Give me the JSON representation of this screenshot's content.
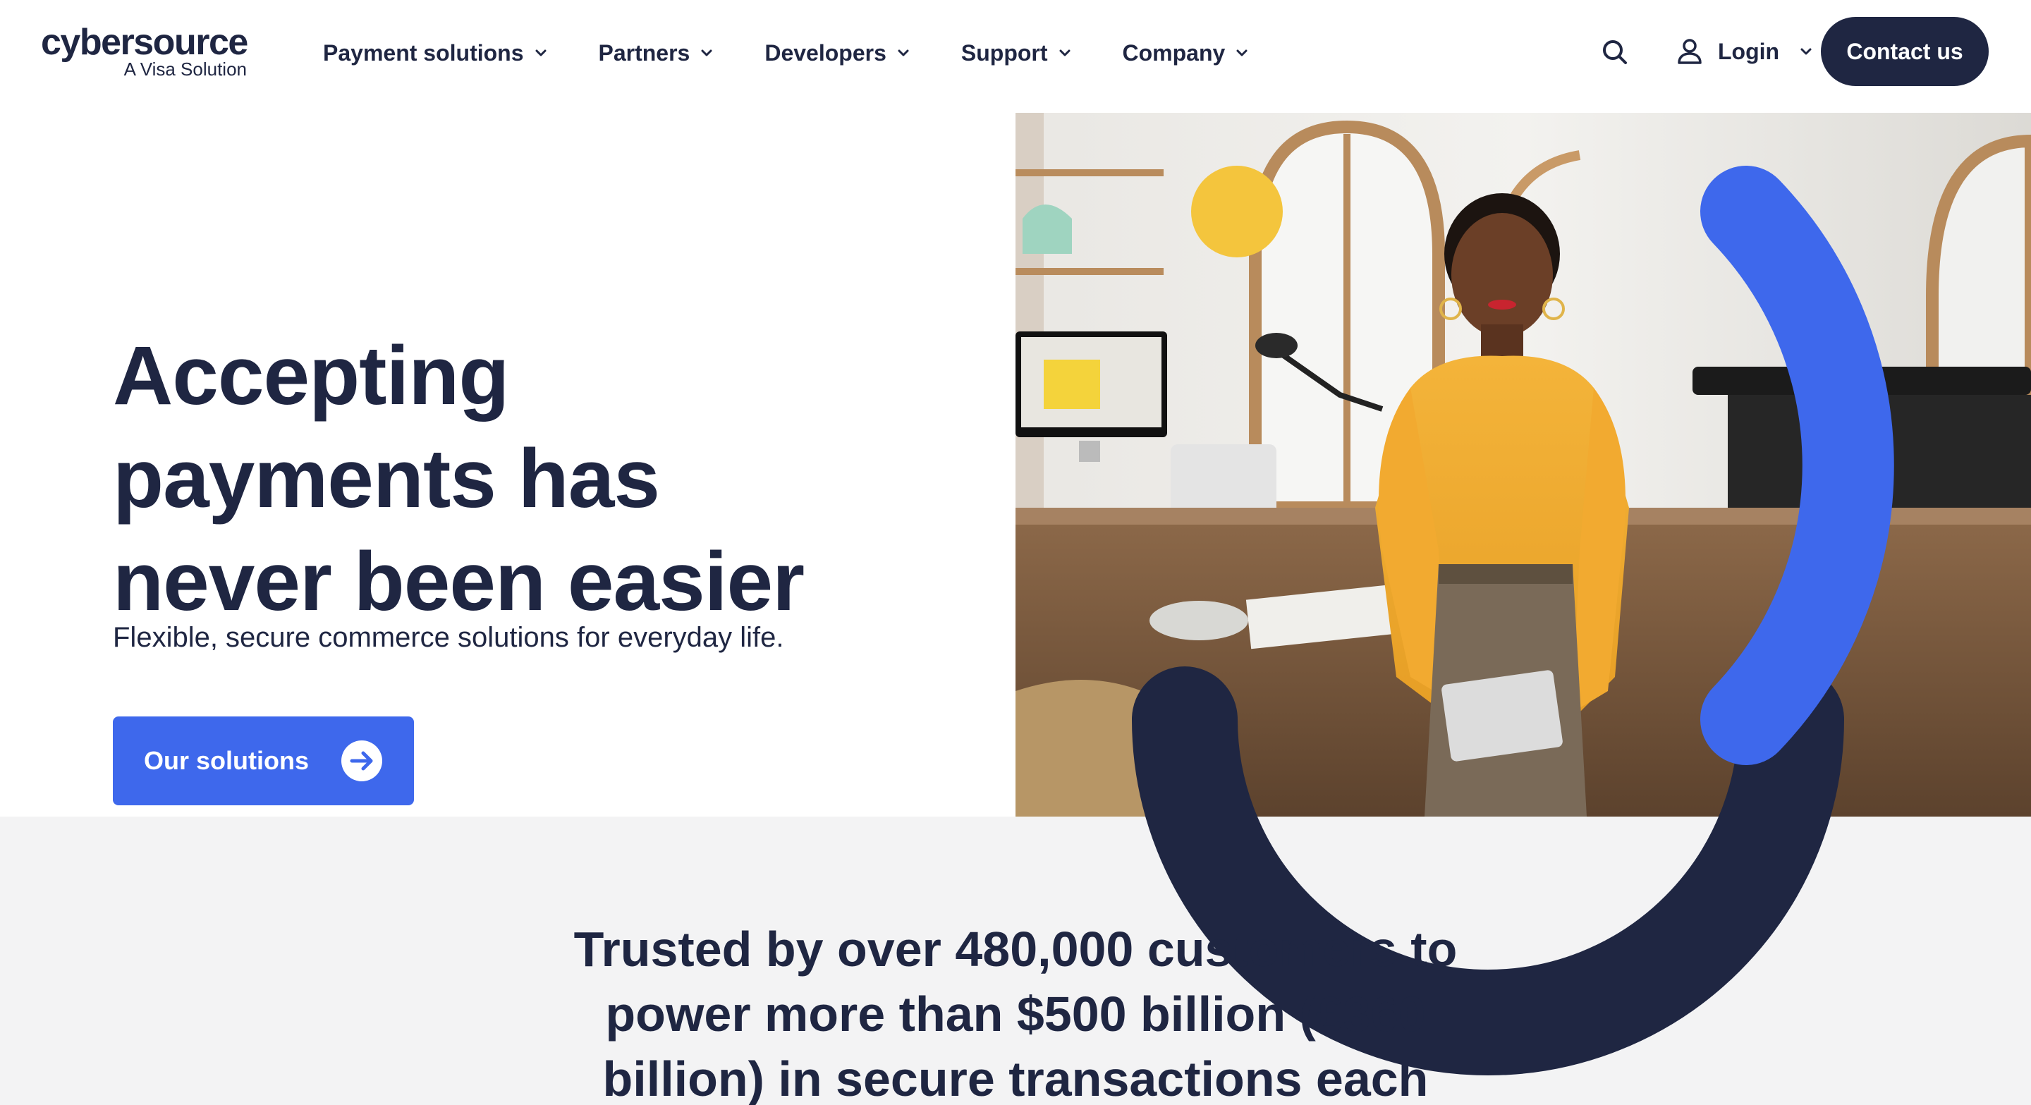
{
  "brand": {
    "name": "cybersource",
    "tagline": "A Visa Solution"
  },
  "nav": {
    "items": [
      {
        "label": "Payment solutions"
      },
      {
        "label": "Partners"
      },
      {
        "label": "Developers"
      },
      {
        "label": "Support"
      },
      {
        "label": "Company"
      }
    ],
    "search_icon": "search-icon",
    "login_label": "Login",
    "contact_label": "Contact us"
  },
  "hero": {
    "title_lines": [
      "Accepting",
      "payments has",
      "never been easier"
    ],
    "subtitle": "Flexible, secure commerce solutions for everyday life.",
    "cta_label": "Our solutions"
  },
  "trust": {
    "lines": [
      "Trusted by over 480,000 customers to",
      "power more than $500 billion (£360",
      "billion) in secure transactions each"
    ]
  },
  "colors": {
    "navy": "#1f2642",
    "accent_blue": "#3e68ec",
    "yellow": "#f4c53d",
    "band_gray": "#f3f3f4"
  }
}
